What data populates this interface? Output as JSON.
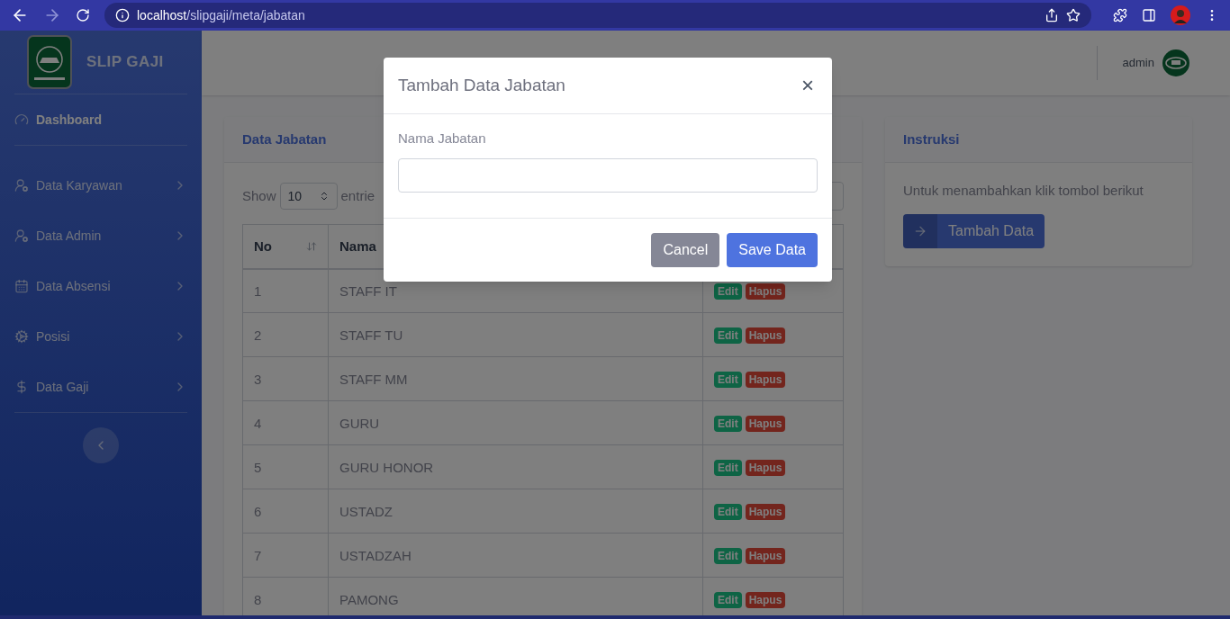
{
  "browser": {
    "url_host": "localhost",
    "url_path": "/slipgaji/meta/jabatan"
  },
  "sidebar": {
    "brand": "SLIP GAJI",
    "items": [
      {
        "label": "Dashboard",
        "kind": "link",
        "selected": true
      },
      {
        "label": "Data Karyawan",
        "kind": "menu",
        "selected": false
      },
      {
        "label": "Data Admin",
        "kind": "menu",
        "selected": false
      },
      {
        "label": "Data Absensi",
        "kind": "menu",
        "selected": false
      },
      {
        "label": "Posisi",
        "kind": "menu",
        "selected": false
      },
      {
        "label": "Data Gaji",
        "kind": "menu",
        "selected": false
      }
    ]
  },
  "topbar": {
    "user": "admin"
  },
  "table_card": {
    "title": "Data Jabatan",
    "show_label": "Show",
    "page_size": "10",
    "entries_label": "entrie",
    "columns": [
      "No",
      "Nama"
    ],
    "rows": [
      {
        "no": "1",
        "name": "STAFF IT",
        "actions": [
          {
            "label": "Edit",
            "kind": "edit"
          },
          {
            "label": "Hapus",
            "kind": "delete"
          }
        ]
      },
      {
        "no": "2",
        "name": "STAFF TU",
        "actions": [
          {
            "label": "Edit",
            "kind": "edit"
          },
          {
            "label": "Hapus",
            "kind": "delete"
          }
        ]
      },
      {
        "no": "3",
        "name": "STAFF MM",
        "actions": [
          {
            "label": "Edit",
            "kind": "edit"
          },
          {
            "label": "Hapus",
            "kind": "delete"
          }
        ]
      },
      {
        "no": "4",
        "name": "GURU",
        "actions": [
          {
            "label": "Edit",
            "kind": "edit"
          },
          {
            "label": "Hapus",
            "kind": "delete"
          }
        ]
      },
      {
        "no": "5",
        "name": "GURU HONOR",
        "actions": [
          {
            "label": "Edit",
            "kind": "edit"
          },
          {
            "label": "Hapus",
            "kind": "delete"
          }
        ]
      },
      {
        "no": "6",
        "name": "USTADZ",
        "actions": [
          {
            "label": "Edit",
            "kind": "edit"
          },
          {
            "label": "Hapus",
            "kind": "delete"
          }
        ]
      },
      {
        "no": "7",
        "name": "USTADZAH",
        "actions": [
          {
            "label": "Edit",
            "kind": "edit"
          },
          {
            "label": "Hapus",
            "kind": "delete"
          }
        ]
      },
      {
        "no": "8",
        "name": "PAMONG",
        "actions": [
          {
            "label": "Edit",
            "kind": "edit"
          },
          {
            "label": "Hapus",
            "kind": "delete"
          }
        ]
      }
    ]
  },
  "instructions": {
    "title": "Instruksi",
    "text": "Untuk menambahkan klik tombol berikut",
    "button": "Tambah Data"
  },
  "modal": {
    "title": "Tambah Data Jabatan",
    "close": "×",
    "field_label": "Nama Jabatan",
    "buttons": [
      {
        "label": "Cancel",
        "kind": "secondary"
      },
      {
        "label": "Save Data",
        "kind": "primary"
      }
    ]
  }
}
